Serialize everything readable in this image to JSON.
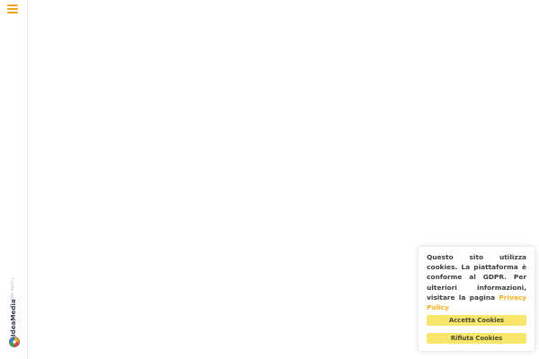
{
  "sidebar": {
    "menu_icon": "hamburger-menu-icon",
    "brand": {
      "name": "IdeaMedia",
      "credit": "Web Agency",
      "logo_icon": "idea-media-logo-icon"
    }
  },
  "cookie_banner": {
    "text": "Questo sito utilizza cookies. La piattaforma è conforme al GDPR. Per ulteriori informazioni, visitare la pagina",
    "link_label": "Privacy Policy",
    "accept_label": "Accetta Cookies",
    "reject_label": "Rifiuta Cookies"
  },
  "colors": {
    "accent": "#f2a11f",
    "button_bg": "#f8e66c",
    "link": "#f2b11f"
  }
}
